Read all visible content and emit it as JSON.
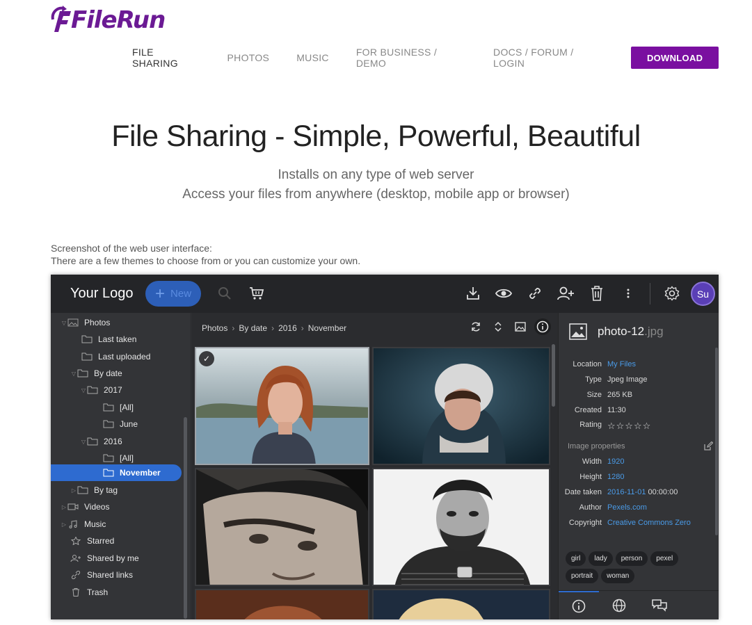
{
  "brand": {
    "name": "FileRun",
    "color": "#6b1a94"
  },
  "nav": {
    "items": [
      "FILE SHARING",
      "PHOTOS",
      "MUSIC",
      "FOR BUSINESS / DEMO",
      "DOCS / FORUM / LOGIN"
    ],
    "download": "DOWNLOAD"
  },
  "hero": {
    "title": "File Sharing - Simple, Powerful, Beautiful",
    "line1": "Installs on any type of web server",
    "line2": "Access your files from anywhere (desktop, mobile app or browser)"
  },
  "caption": {
    "line1": "Screenshot of the web user interface:",
    "line2": "There are a few themes to choose from or you can customize your own."
  },
  "app": {
    "logo": "Your Logo",
    "new_label": "New",
    "avatar": "Su",
    "toolbar_icons": [
      "search-icon",
      "cart-icon",
      "download-icon",
      "eye-icon",
      "link-icon",
      "add-user-icon",
      "trash-icon",
      "more-icon",
      "gear-icon"
    ],
    "sidebar": [
      {
        "label": "Photos"
      },
      {
        "label": "Last taken"
      },
      {
        "label": "Last uploaded"
      },
      {
        "label": "By date"
      },
      {
        "label": "2017"
      },
      {
        "label": "[All]"
      },
      {
        "label": "June"
      },
      {
        "label": "2016"
      },
      {
        "label": "[All]"
      },
      {
        "label": "November"
      },
      {
        "label": "By tag"
      },
      {
        "label": "Videos"
      },
      {
        "label": "Music"
      },
      {
        "label": "Starred"
      },
      {
        "label": "Shared by me"
      },
      {
        "label": "Shared links"
      },
      {
        "label": "Trash"
      }
    ],
    "breadcrumb": [
      "Photos",
      "By date",
      "2016",
      "November"
    ],
    "details": {
      "filename": "photo-12",
      "extension": ".jpg",
      "properties": [
        {
          "key": "Location",
          "value": "My Files",
          "link": true
        },
        {
          "key": "Type",
          "value": "Jpeg Image",
          "link": false
        },
        {
          "key": "Size",
          "value": "265 KB",
          "link": false
        },
        {
          "key": "Created",
          "value": "11:30",
          "link": false
        },
        {
          "key": "Rating",
          "value": "☆☆☆☆☆",
          "link": false
        }
      ],
      "image_properties_title": "Image properties",
      "image_properties": [
        {
          "key": "Width",
          "value": "1920",
          "link": true
        },
        {
          "key": "Height",
          "value": "1280",
          "link": true
        },
        {
          "key": "Date taken",
          "value": "2016-11-01",
          "extra": " 00:00:00",
          "link": true
        },
        {
          "key": "Author",
          "value": "Pexels.com",
          "link": true
        },
        {
          "key": "Copyright",
          "value": "Creative Commons Zero",
          "link": true
        }
      ],
      "tags": [
        "girl",
        "lady",
        "person",
        "pexel",
        "portrait",
        "woman"
      ]
    },
    "colors": {
      "accent": "#2e6bd0",
      "link": "#4a9be8",
      "download": "#7a0fa0"
    }
  }
}
